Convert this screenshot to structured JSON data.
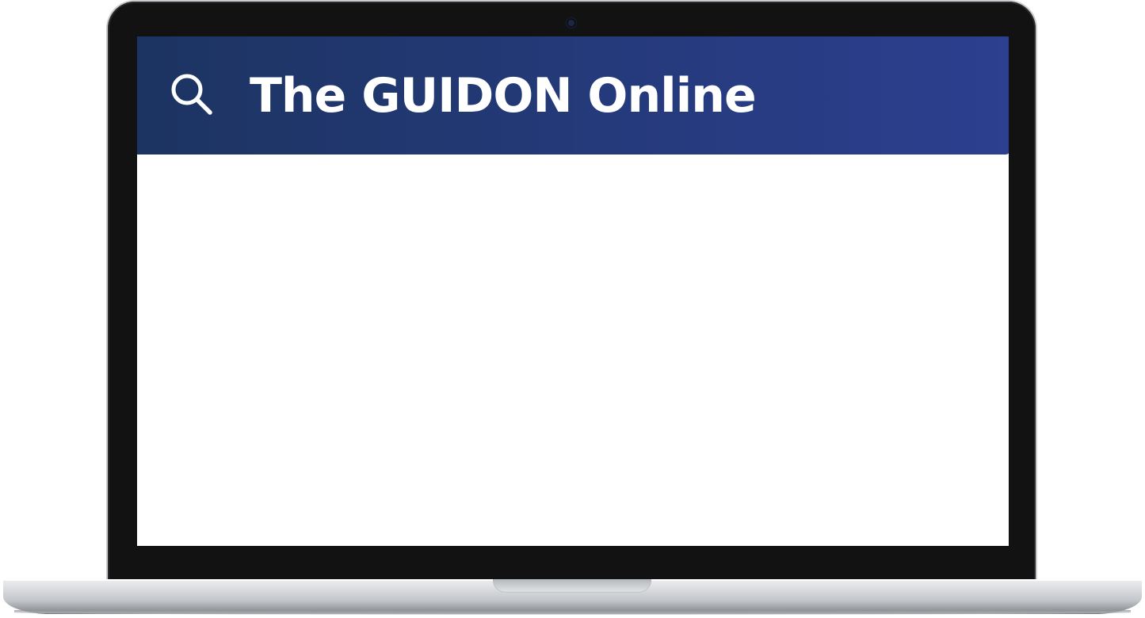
{
  "site": {
    "title": "The GUIDON Online"
  },
  "header": {
    "search_icon": "search-icon",
    "gradient_start": "#1c3461",
    "gradient_end": "#2c3f90"
  },
  "device": {
    "bezel_color": "#121212",
    "screen_color": "#ffffff"
  }
}
